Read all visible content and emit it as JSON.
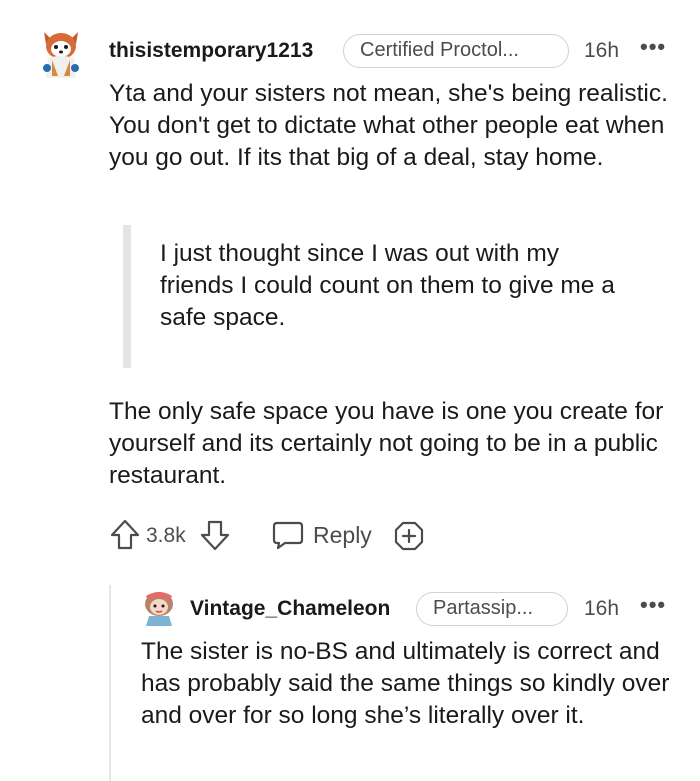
{
  "comment": {
    "username": "thisistemporary1213",
    "flair": "Certified Proctol...",
    "time": "16h",
    "paragraph1": "Yta and your sisters not mean, she's being realistic. You don't get to dictate what other people eat when you go out. If its that big of a deal, stay home.",
    "quote": "I just thought since I was out with my friends I could count on them to give me a safe space.",
    "paragraph2": "The only safe space you have is one you create for yourself and its certainly not going to be in a public restaurant.",
    "score": "3.8k",
    "reply_label": "Reply"
  },
  "reply": {
    "username": "Vintage_Chameleon",
    "flair": "Partassip...",
    "time": "16h",
    "text": "The sister is no-BS and ultimately is correct and has probably said the same things so kindly over and over for so long she’s literally over it."
  },
  "icons": {
    "avatar1": "red-panda-avatar",
    "avatar2": "girl-avatar",
    "upvote": "upvote-arrow-icon",
    "downvote": "downvote-arrow-icon",
    "reply": "speech-bubble-icon",
    "award": "add-award-icon",
    "more": "more-options-icon"
  },
  "colors": {
    "text": "#1a1a1b",
    "meta": "#4a4d50",
    "quote_bar": "#e4e4e4"
  }
}
